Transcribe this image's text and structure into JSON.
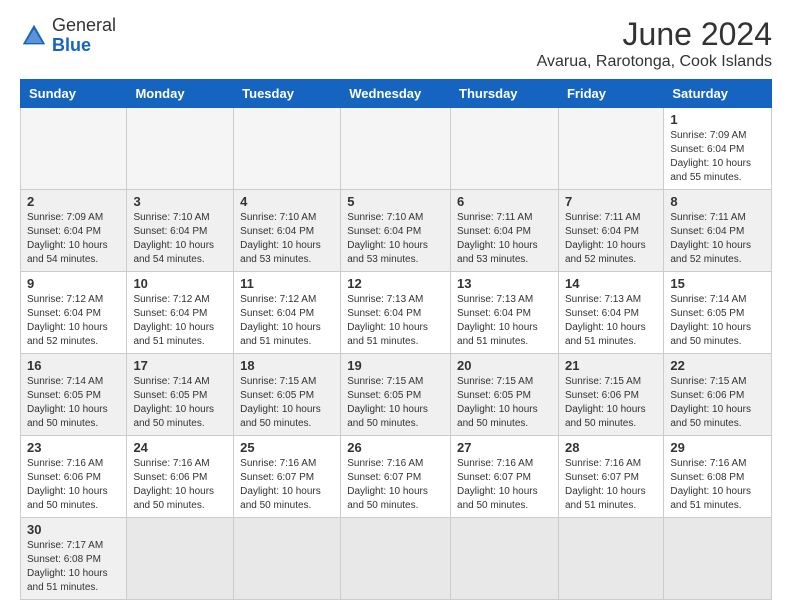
{
  "header": {
    "logo_general": "General",
    "logo_blue": "Blue",
    "title": "June 2024",
    "subtitle": "Avarua, Rarotonga, Cook Islands"
  },
  "days_of_week": [
    "Sunday",
    "Monday",
    "Tuesday",
    "Wednesday",
    "Thursday",
    "Friday",
    "Saturday"
  ],
  "weeks": [
    [
      {
        "num": "",
        "info": ""
      },
      {
        "num": "",
        "info": ""
      },
      {
        "num": "",
        "info": ""
      },
      {
        "num": "",
        "info": ""
      },
      {
        "num": "",
        "info": ""
      },
      {
        "num": "",
        "info": ""
      },
      {
        "num": "1",
        "info": "Sunrise: 7:09 AM\nSunset: 6:04 PM\nDaylight: 10 hours\nand 55 minutes."
      }
    ],
    [
      {
        "num": "2",
        "info": "Sunrise: 7:09 AM\nSunset: 6:04 PM\nDaylight: 10 hours\nand 54 minutes."
      },
      {
        "num": "3",
        "info": "Sunrise: 7:10 AM\nSunset: 6:04 PM\nDaylight: 10 hours\nand 54 minutes."
      },
      {
        "num": "4",
        "info": "Sunrise: 7:10 AM\nSunset: 6:04 PM\nDaylight: 10 hours\nand 53 minutes."
      },
      {
        "num": "5",
        "info": "Sunrise: 7:10 AM\nSunset: 6:04 PM\nDaylight: 10 hours\nand 53 minutes."
      },
      {
        "num": "6",
        "info": "Sunrise: 7:11 AM\nSunset: 6:04 PM\nDaylight: 10 hours\nand 53 minutes."
      },
      {
        "num": "7",
        "info": "Sunrise: 7:11 AM\nSunset: 6:04 PM\nDaylight: 10 hours\nand 52 minutes."
      },
      {
        "num": "8",
        "info": "Sunrise: 7:11 AM\nSunset: 6:04 PM\nDaylight: 10 hours\nand 52 minutes."
      }
    ],
    [
      {
        "num": "9",
        "info": "Sunrise: 7:12 AM\nSunset: 6:04 PM\nDaylight: 10 hours\nand 52 minutes."
      },
      {
        "num": "10",
        "info": "Sunrise: 7:12 AM\nSunset: 6:04 PM\nDaylight: 10 hours\nand 51 minutes."
      },
      {
        "num": "11",
        "info": "Sunrise: 7:12 AM\nSunset: 6:04 PM\nDaylight: 10 hours\nand 51 minutes."
      },
      {
        "num": "12",
        "info": "Sunrise: 7:13 AM\nSunset: 6:04 PM\nDaylight: 10 hours\nand 51 minutes."
      },
      {
        "num": "13",
        "info": "Sunrise: 7:13 AM\nSunset: 6:04 PM\nDaylight: 10 hours\nand 51 minutes."
      },
      {
        "num": "14",
        "info": "Sunrise: 7:13 AM\nSunset: 6:04 PM\nDaylight: 10 hours\nand 51 minutes."
      },
      {
        "num": "15",
        "info": "Sunrise: 7:14 AM\nSunset: 6:05 PM\nDaylight: 10 hours\nand 50 minutes."
      }
    ],
    [
      {
        "num": "16",
        "info": "Sunrise: 7:14 AM\nSunset: 6:05 PM\nDaylight: 10 hours\nand 50 minutes."
      },
      {
        "num": "17",
        "info": "Sunrise: 7:14 AM\nSunset: 6:05 PM\nDaylight: 10 hours\nand 50 minutes."
      },
      {
        "num": "18",
        "info": "Sunrise: 7:15 AM\nSunset: 6:05 PM\nDaylight: 10 hours\nand 50 minutes."
      },
      {
        "num": "19",
        "info": "Sunrise: 7:15 AM\nSunset: 6:05 PM\nDaylight: 10 hours\nand 50 minutes."
      },
      {
        "num": "20",
        "info": "Sunrise: 7:15 AM\nSunset: 6:05 PM\nDaylight: 10 hours\nand 50 minutes."
      },
      {
        "num": "21",
        "info": "Sunrise: 7:15 AM\nSunset: 6:06 PM\nDaylight: 10 hours\nand 50 minutes."
      },
      {
        "num": "22",
        "info": "Sunrise: 7:15 AM\nSunset: 6:06 PM\nDaylight: 10 hours\nand 50 minutes."
      }
    ],
    [
      {
        "num": "23",
        "info": "Sunrise: 7:16 AM\nSunset: 6:06 PM\nDaylight: 10 hours\nand 50 minutes."
      },
      {
        "num": "24",
        "info": "Sunrise: 7:16 AM\nSunset: 6:06 PM\nDaylight: 10 hours\nand 50 minutes."
      },
      {
        "num": "25",
        "info": "Sunrise: 7:16 AM\nSunset: 6:07 PM\nDaylight: 10 hours\nand 50 minutes."
      },
      {
        "num": "26",
        "info": "Sunrise: 7:16 AM\nSunset: 6:07 PM\nDaylight: 10 hours\nand 50 minutes."
      },
      {
        "num": "27",
        "info": "Sunrise: 7:16 AM\nSunset: 6:07 PM\nDaylight: 10 hours\nand 50 minutes."
      },
      {
        "num": "28",
        "info": "Sunrise: 7:16 AM\nSunset: 6:07 PM\nDaylight: 10 hours\nand 51 minutes."
      },
      {
        "num": "29",
        "info": "Sunrise: 7:16 AM\nSunset: 6:08 PM\nDaylight: 10 hours\nand 51 minutes."
      }
    ],
    [
      {
        "num": "30",
        "info": "Sunrise: 7:17 AM\nSunset: 6:08 PM\nDaylight: 10 hours\nand 51 minutes."
      },
      {
        "num": "",
        "info": ""
      },
      {
        "num": "",
        "info": ""
      },
      {
        "num": "",
        "info": ""
      },
      {
        "num": "",
        "info": ""
      },
      {
        "num": "",
        "info": ""
      },
      {
        "num": "",
        "info": ""
      }
    ]
  ]
}
